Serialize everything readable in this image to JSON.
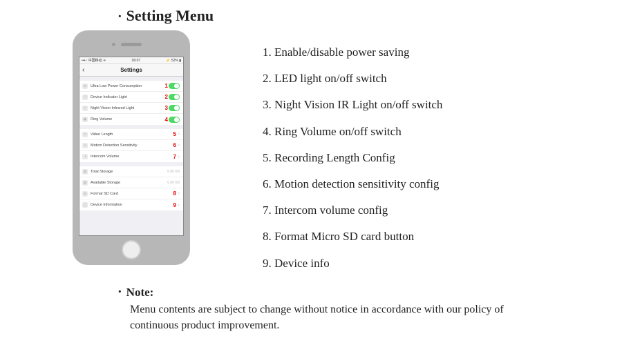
{
  "heading": "Setting Menu",
  "bullet": "·",
  "phone": {
    "status": {
      "left": "•••○ 中国移动 ⚞",
      "center": "09:07",
      "right": "⚡ 52% ▮"
    },
    "nav": {
      "back": "‹",
      "title": "Settings"
    },
    "groups": [
      {
        "rows": [
          {
            "icon": "⊘",
            "label": "Ultra Low Power Consumption",
            "num": "1",
            "toggle": true
          },
          {
            "icon": "❍",
            "label": "Device Indicator Light",
            "num": "2",
            "toggle": true
          },
          {
            "icon": "✧",
            "label": "Night Vision Infrared Light",
            "num": "3",
            "toggle": true
          },
          {
            "icon": "◉",
            "label": "Ring Volume",
            "num": "4",
            "toggle": true
          }
        ]
      },
      {
        "rows": [
          {
            "icon": "▭",
            "label": "Video Length",
            "num": "5",
            "chev": true
          },
          {
            "icon": "⤳",
            "label": "Motion Detection Sensitivity",
            "num": "6",
            "chev": true
          },
          {
            "icon": "◑",
            "label": "Intercom Volume",
            "num": "7",
            "chev": true
          }
        ]
      },
      {
        "rows": [
          {
            "icon": "▥",
            "label": "Total Storage",
            "value": "0.00 KB"
          },
          {
            "icon": "▤",
            "label": "Available Storage",
            "value": "0.00 KB"
          },
          {
            "icon": "⊟",
            "label": "Format SD Card",
            "num": "8",
            "chev": true
          },
          {
            "icon": "ⓘ",
            "label": "Device Information",
            "num": "9",
            "chev": true
          }
        ]
      }
    ]
  },
  "legend": [
    "1. Enable/disable power saving",
    "2. LED light on/off switch",
    "3. Night Vision IR Light on/off switch",
    "4. Ring Volume on/off switch",
    "5. Recording Length Config",
    "6. Motion detection sensitivity config",
    "7. Intercom volume config",
    "8. Format Micro SD card button",
    "9. Device info"
  ],
  "note": {
    "label": "Note:",
    "text": "Menu contents are subject to change without notice in accordance with our policy of continuous product improvement."
  }
}
